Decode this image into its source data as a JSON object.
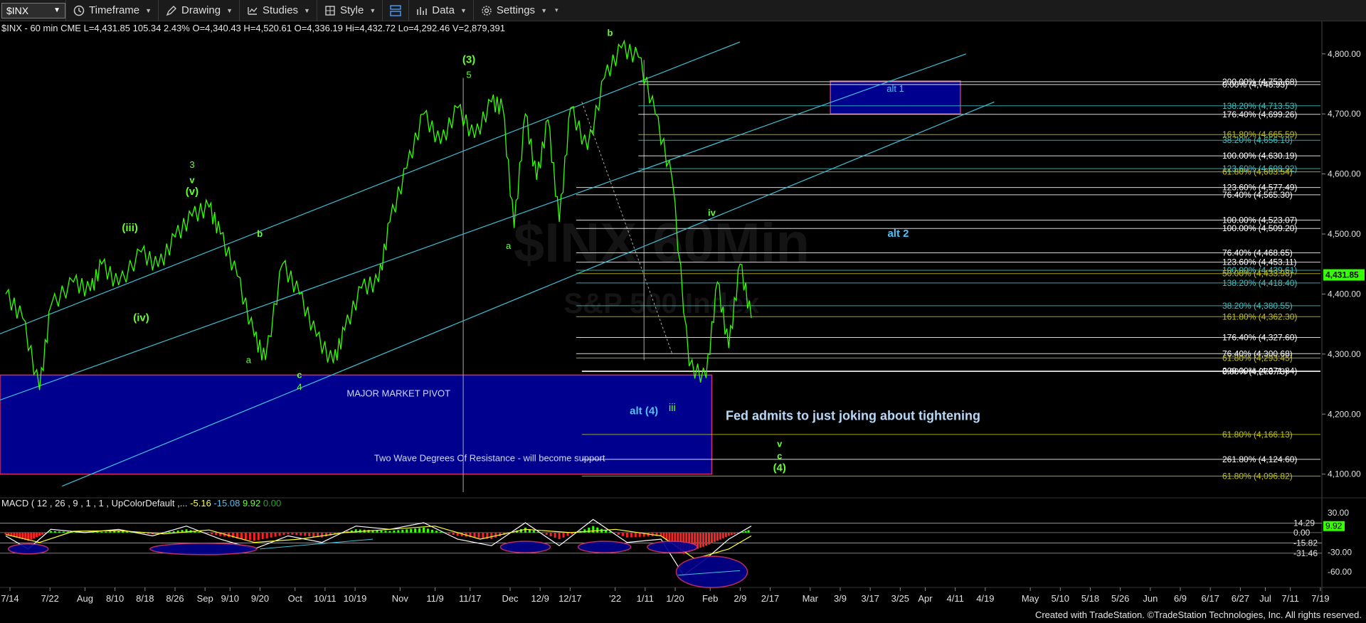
{
  "toolbar": {
    "symbol": "$INX",
    "items": [
      {
        "label": "Timeframe",
        "icon": "clock-icon"
      },
      {
        "label": "Drawing",
        "icon": "pen-icon"
      },
      {
        "label": "Studies",
        "icon": "studies-icon"
      },
      {
        "label": "Style",
        "icon": "style-icon"
      },
      {
        "label": "",
        "icon": "layout-icon"
      },
      {
        "label": "Data",
        "icon": "data-icon"
      },
      {
        "label": "Settings",
        "icon": "gear-icon"
      }
    ]
  },
  "header": {
    "text": "$INX - 60 min  CME  L=4,431.85  105.34  2.43%  O=4,340.43  H=4,520.61  O=4,336.19  Hi=4,432.72  Lo=4,292.46  V=2,879,391"
  },
  "watermark": {
    "symbol": "$INX 60Min",
    "name": "S&P 500 Index"
  },
  "macd": {
    "label": "MACD ( 12 , 26 , 9 , 1 , 1 , UpColorDefault ,...",
    "v1": "-5.16",
    "v2": "-15.08",
    "v3": "9.92",
    "v4": "0.00"
  },
  "footer": "Created with TradeStation. ©TradeStation Technologies, Inc. All rights reserved.",
  "chart_data": {
    "type": "line",
    "title": "$INX - 60 min",
    "ylim": [
      4070,
      4840
    ],
    "y_ticks": [
      "4,100.00",
      "4,200.00",
      "4,300.00",
      "4,400.00",
      "4,500.00",
      "4,600.00",
      "4,700.00",
      "4,800.00"
    ],
    "last_price": "4,431.85",
    "x_ticks": [
      "7/14",
      "7/22",
      "Aug",
      "8/10",
      "8/18",
      "8/26",
      "Sep",
      "9/10",
      "9/20",
      "Oct",
      "10/11",
      "10/19",
      "Nov",
      "11/9",
      "11/17",
      "Dec",
      "12/9",
      "12/17",
      "'22",
      "1/11",
      "1/20",
      "Feb",
      "2/9",
      "2/17",
      "Mar",
      "3/9",
      "3/17",
      "3/25",
      "Apr",
      "4/11",
      "4/19",
      "May",
      "5/10",
      "5/18",
      "5/26",
      "Jun",
      "6/9",
      "6/17",
      "6/27",
      "Jul",
      "7/11",
      "7/19"
    ],
    "series": [
      {
        "x": [
          0,
          3,
          6,
          8,
          12,
          15,
          17,
          20,
          24,
          27,
          30,
          33,
          36,
          38,
          41,
          44,
          46,
          49,
          52,
          55,
          58,
          60,
          63,
          66,
          68,
          71,
          74,
          77,
          80,
          83,
          86,
          88,
          90,
          92,
          94,
          96,
          98,
          100,
          103,
          106,
          109,
          112,
          115,
          118,
          121,
          124
        ],
        "y": [
          4400,
          4360,
          4240,
          4380,
          4420,
          4405,
          4450,
          4415,
          4470,
          4445,
          4495,
          4530,
          4545,
          4500,
          4430,
          4330,
          4290,
          4450,
          4400,
          4330,
          4285,
          4340,
          4410,
          4420,
          4520,
          4610,
          4700,
          4650,
          4710,
          4660,
          4720,
          4710,
          4510,
          4700,
          4590,
          4690,
          4520,
          4710,
          4640,
          4760,
          4810,
          4795,
          4700,
          4590,
          4280,
          4260
        ]
      },
      {
        "x": [
          124,
          126,
          128,
          130,
          132
        ],
        "y": [
          4260,
          4420,
          4310,
          4450,
          4360
        ]
      }
    ],
    "fib_levels": [
      {
        "label": "200.00% (4,753.68)",
        "value": 4753.68,
        "color": "#ffffff"
      },
      {
        "label": "0.00% (4,748.93)",
        "value": 4748.93,
        "color": "#ffffff"
      },
      {
        "label": "138.20% (4,713.53)",
        "value": 4713.53,
        "color": "#40c0c0"
      },
      {
        "label": "176.40% (4,699.26)",
        "value": 4699.26,
        "color": "#ffffff"
      },
      {
        "label": "161.80% (4,665.59)",
        "value": 4665.59,
        "color": "#c0c020"
      },
      {
        "label": "38.20% (4,656.10)",
        "value": 4656.1,
        "color": "#40c0c0"
      },
      {
        "label": "100.00% (4,630.19)",
        "value": 4630.19,
        "color": "#ffffff"
      },
      {
        "label": "123.60% (4,608.92)",
        "value": 4608.92,
        "color": "#40c0c0"
      },
      {
        "label": "61.80% (4,603.54)",
        "value": 4603.54,
        "color": "#c0c020"
      },
      {
        "label": "123.60% (4,577.49)",
        "value": 4577.49,
        "color": "#ffffff"
      },
      {
        "label": "76.40% (4,565.30)",
        "value": 4565.3,
        "color": "#ffffff"
      },
      {
        "label": "100.00% (4,523.07)",
        "value": 4523.07,
        "color": "#ffffff"
      },
      {
        "label": "100.00% (4,509.20)",
        "value": 4509.2,
        "color": "#ffffff"
      },
      {
        "label": "76.40% (4,468.65)",
        "value": 4468.65,
        "color": "#ffffff"
      },
      {
        "label": "123.60% (4,453.11)",
        "value": 4453.11,
        "color": "#ffffff"
      },
      {
        "label": "100.00% (4,439.61)",
        "value": 4439.61,
        "color": "#40c0c0"
      },
      {
        "label": "50.00% (4,433.98)",
        "value": 4433.98,
        "color": "#c0c020"
      },
      {
        "label": "138.20% (4,418.40)",
        "value": 4418.4,
        "color": "#40c0c0"
      },
      {
        "label": "38.20% (4,380.55)",
        "value": 4380.55,
        "color": "#40c0c0"
      },
      {
        "label": "161.80% (4,362.30)",
        "value": 4362.3,
        "color": "#c0c020"
      },
      {
        "label": "176.40% (4,327.60)",
        "value": 4327.6,
        "color": "#ffffff"
      },
      {
        "label": "76.40% (4,300.68)",
        "value": 4300.68,
        "color": "#ffffff"
      },
      {
        "label": "61.80% (4,293.45)",
        "value": 4293.45,
        "color": "#c0c020"
      },
      {
        "label": "200.00% (4,271.84)",
        "value": 4271.84,
        "color": "#ffffff"
      },
      {
        "label": "0.00% (4,270.73)",
        "value": 4270.73,
        "color": "#ffffff"
      },
      {
        "label": "61.80% (4,166.13)",
        "value": 4166.13,
        "color": "#c0c020"
      },
      {
        "label": "261.80% (4,124.60)",
        "value": 4124.6,
        "color": "#ffffff"
      },
      {
        "label": "61.80% (4,096.82)",
        "value": 4096.82,
        "color": "#c0c020"
      }
    ],
    "boxes": [
      {
        "label": "MAJOR MARKET PIVOT",
        "x1": -1,
        "x2": 125,
        "y1": 4265,
        "y2": 4100,
        "text2": "Two Wave Degrees Of Resistance - will become support"
      },
      {
        "label": "alt 1",
        "x1": 146,
        "x2": 169,
        "y1": 4755,
        "y2": 4700
      }
    ],
    "annotations": [
      {
        "text": "b",
        "x": 107,
        "y": 4830,
        "color": "#66ff33"
      },
      {
        "text": "(3)",
        "x": 82,
        "y": 4785,
        "color": "#66ff33"
      },
      {
        "text": "5",
        "x": 82,
        "y": 4760,
        "color": "#66ff33"
      },
      {
        "text": "3",
        "x": 33,
        "y": 4610,
        "color": "#66ff33"
      },
      {
        "text": "v",
        "x": 33,
        "y": 4585,
        "color": "#66ff33"
      },
      {
        "text": "(v)",
        "x": 33,
        "y": 4565,
        "color": "#66ff33"
      },
      {
        "text": "(iii)",
        "x": 22,
        "y": 4505,
        "color": "#66ff33"
      },
      {
        "text": "(iv)",
        "x": 24,
        "y": 4355,
        "color": "#66ff33"
      },
      {
        "text": "b",
        "x": 45,
        "y": 4495,
        "color": "#66ff33"
      },
      {
        "text": "a",
        "x": 43,
        "y": 4285,
        "color": "#66ff33"
      },
      {
        "text": "c",
        "x": 52,
        "y": 4260,
        "color": "#66ff33"
      },
      {
        "text": "4",
        "x": 52,
        "y": 4240,
        "color": "#66ff33"
      },
      {
        "text": "a",
        "x": 89,
        "y": 4475,
        "color": "#66ff33"
      },
      {
        "text": "iv",
        "x": 125,
        "y": 4530,
        "color": "#66ff33"
      },
      {
        "text": "iii",
        "x": 118,
        "y": 4205,
        "color": "#66ff33"
      },
      {
        "text": "alt (4)",
        "x": 113,
        "y": 4200,
        "color": "#4fc3f7"
      },
      {
        "text": "alt 2",
        "x": 158,
        "y": 4495,
        "color": "#4fc3f7"
      },
      {
        "text": "v",
        "x": 137,
        "y": 4145,
        "color": "#66ff33"
      },
      {
        "text": "c",
        "x": 137,
        "y": 4125,
        "color": "#66ff33"
      },
      {
        "text": "(4)",
        "x": 137,
        "y": 4105,
        "color": "#66ff33"
      },
      {
        "text": "Fed admits to just joking about tightening",
        "x": 150,
        "y": 4190,
        "color": "#b8d8f8"
      }
    ],
    "channel_lines": [
      {
        "x1": -2,
        "y1": 4330,
        "x2": 130,
        "y2": 4820
      },
      {
        "x1": -2,
        "y1": 4220,
        "x2": 170,
        "y2": 4800
      },
      {
        "x1": 10,
        "y1": 4080,
        "x2": 175,
        "y2": 4720
      }
    ],
    "macd_ticks": [
      "30.00",
      "14.29",
      "9.92",
      "0.00",
      "-15.82",
      "-31.46",
      "-30.00",
      "-60.00"
    ],
    "macd_ylim": [
      -75,
      40
    ],
    "macd_macd": [
      {
        "x": 0,
        "y": -5
      },
      {
        "x": 4,
        "y": -25
      },
      {
        "x": 8,
        "y": 5
      },
      {
        "x": 14,
        "y": 0
      },
      {
        "x": 20,
        "y": 5
      },
      {
        "x": 26,
        "y": -5
      },
      {
        "x": 32,
        "y": 10
      },
      {
        "x": 38,
        "y": -10
      },
      {
        "x": 44,
        "y": -25
      },
      {
        "x": 50,
        "y": -5
      },
      {
        "x": 56,
        "y": -15
      },
      {
        "x": 62,
        "y": 10
      },
      {
        "x": 68,
        "y": 5
      },
      {
        "x": 74,
        "y": 15
      },
      {
        "x": 80,
        "y": -10
      },
      {
        "x": 86,
        "y": -20
      },
      {
        "x": 92,
        "y": 15
      },
      {
        "x": 98,
        "y": -20
      },
      {
        "x": 104,
        "y": 20
      },
      {
        "x": 110,
        "y": -15
      },
      {
        "x": 116,
        "y": -10
      },
      {
        "x": 120,
        "y": -65
      },
      {
        "x": 124,
        "y": -40
      },
      {
        "x": 128,
        "y": -10
      },
      {
        "x": 132,
        "y": 10
      }
    ],
    "macd_signal": [
      {
        "x": 0,
        "y": -3
      },
      {
        "x": 6,
        "y": -15
      },
      {
        "x": 12,
        "y": 2
      },
      {
        "x": 20,
        "y": 3
      },
      {
        "x": 28,
        "y": -2
      },
      {
        "x": 36,
        "y": 4
      },
      {
        "x": 44,
        "y": -15
      },
      {
        "x": 52,
        "y": -10
      },
      {
        "x": 60,
        "y": 0
      },
      {
        "x": 68,
        "y": 5
      },
      {
        "x": 76,
        "y": 10
      },
      {
        "x": 84,
        "y": -10
      },
      {
        "x": 92,
        "y": 5
      },
      {
        "x": 100,
        "y": 0
      },
      {
        "x": 108,
        "y": 5
      },
      {
        "x": 116,
        "y": -5
      },
      {
        "x": 122,
        "y": -40
      },
      {
        "x": 128,
        "y": -25
      },
      {
        "x": 132,
        "y": -5
      }
    ]
  }
}
